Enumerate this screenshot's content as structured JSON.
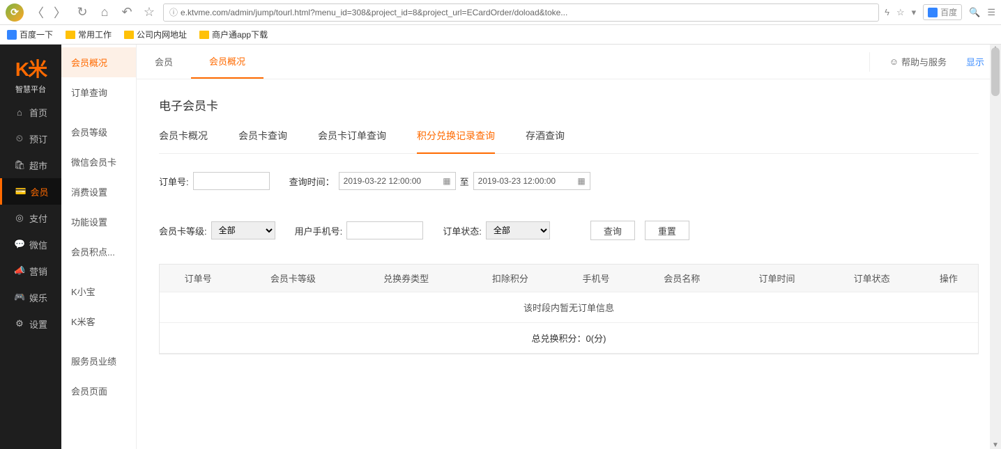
{
  "browser": {
    "url": "e.ktvme.com/admin/jump/tourl.html?menu_id=308&project_id=8&project_url=ECardOrder/doload&toke...",
    "search_engine": "百度"
  },
  "bookmarks": [
    {
      "label": "百度一下",
      "icon": "paw"
    },
    {
      "label": "常用工作",
      "icon": "folder"
    },
    {
      "label": "公司内网地址",
      "icon": "folder"
    },
    {
      "label": "商户通app下载",
      "icon": "folder"
    }
  ],
  "brand": {
    "logo": "K米",
    "sub": "智慧平台"
  },
  "dark_nav": [
    {
      "icon": "⌂",
      "label": "首页"
    },
    {
      "icon": "⏲",
      "label": "预订"
    },
    {
      "icon": "🛍",
      "label": "超市"
    },
    {
      "icon": "💳",
      "label": "会员",
      "active": true
    },
    {
      "icon": "◎",
      "label": "支付"
    },
    {
      "icon": "💬",
      "label": "微信"
    },
    {
      "icon": "📣",
      "label": "营销"
    },
    {
      "icon": "🎮",
      "label": "娱乐"
    },
    {
      "icon": "⚙",
      "label": "设置"
    }
  ],
  "light_nav": [
    {
      "label": "会员概况",
      "active": true
    },
    {
      "label": "订单查询"
    },
    {
      "label": "会员等级"
    },
    {
      "label": "微信会员卡"
    },
    {
      "label": "消费设置"
    },
    {
      "label": "功能设置"
    },
    {
      "label": "会员积点..."
    },
    {
      "label": "K小宝"
    },
    {
      "label": "K米客"
    },
    {
      "label": "服务员业绩"
    },
    {
      "label": "会员页面"
    }
  ],
  "top_tabs": [
    {
      "label": "会员"
    },
    {
      "label": "会员概况",
      "active": true
    }
  ],
  "topbar": {
    "help": "帮助与服务",
    "display": "显示"
  },
  "page": {
    "title": "电子会员卡",
    "sub_tabs": [
      {
        "label": "会员卡概况"
      },
      {
        "label": "会员卡查询"
      },
      {
        "label": "会员卡订单查询"
      },
      {
        "label": "积分兑换记录查询",
        "active": true
      },
      {
        "label": "存酒查询"
      }
    ]
  },
  "filters": {
    "order_no_label": "订单号:",
    "order_no_value": "",
    "time_label": "查询时间：",
    "date_from": "2019-03-22 12:00:00",
    "to": "至",
    "date_to": "2019-03-23 12:00:00",
    "level_label": "会员卡等级:",
    "level_value": "全部",
    "phone_label": "用户手机号:",
    "phone_value": "",
    "status_label": "订单状态:",
    "status_value": "全部",
    "search_btn": "查询",
    "reset_btn": "重置"
  },
  "table": {
    "headers": [
      "订单号",
      "会员卡等级",
      "兑换券类型",
      "扣除积分",
      "手机号",
      "会员名称",
      "订单时间",
      "订单状态",
      "操作"
    ],
    "empty": "该时段内暂无订单信息",
    "summary": "总兑换积分：0(分)"
  }
}
